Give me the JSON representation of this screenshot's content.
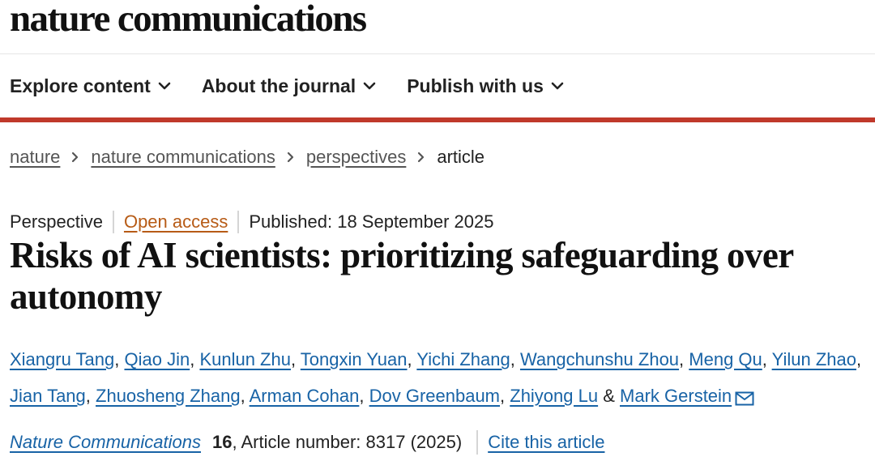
{
  "site": {
    "logo": "nature communications"
  },
  "nav": {
    "items": [
      {
        "label": "Explore content",
        "icon": "chevron-down-icon"
      },
      {
        "label": "About the journal",
        "icon": "chevron-down-icon"
      },
      {
        "label": "Publish with us",
        "icon": "chevron-down-icon"
      }
    ]
  },
  "colors": {
    "accent_bar": "#c0392b",
    "link": "#1863a6",
    "open_access": "#b75b16"
  },
  "breadcrumb": {
    "items": [
      "nature",
      "nature communications",
      "perspectives"
    ],
    "current": "article",
    "separator_icon": "chevron-right-icon"
  },
  "article": {
    "type": "Perspective",
    "access": "Open access",
    "published": "Published: 18 September 2025",
    "title": "Risks of AI scientists: prioritizing safeguarding over autonomy",
    "authors": [
      "Xiangru Tang",
      "Qiao Jin",
      "Kunlun Zhu",
      "Tongxin Yuan",
      "Yichi Zhang",
      "Wangchunshu Zhou",
      "Meng Qu",
      "Yilun Zhao",
      "Jian Tang",
      "Zhuosheng Zhang",
      "Arman Cohan",
      "Dov Greenbaum",
      "Zhiyong Lu",
      "Mark Gerstein"
    ],
    "author_separator": ", ",
    "author_last_joiner": " & ",
    "corresponding_icon": "mail-icon"
  },
  "citation": {
    "journal": "Nature Communications",
    "volume": "16",
    "article_number": ", Article number: 8317 (2025)",
    "cite_label": "Cite this article"
  }
}
